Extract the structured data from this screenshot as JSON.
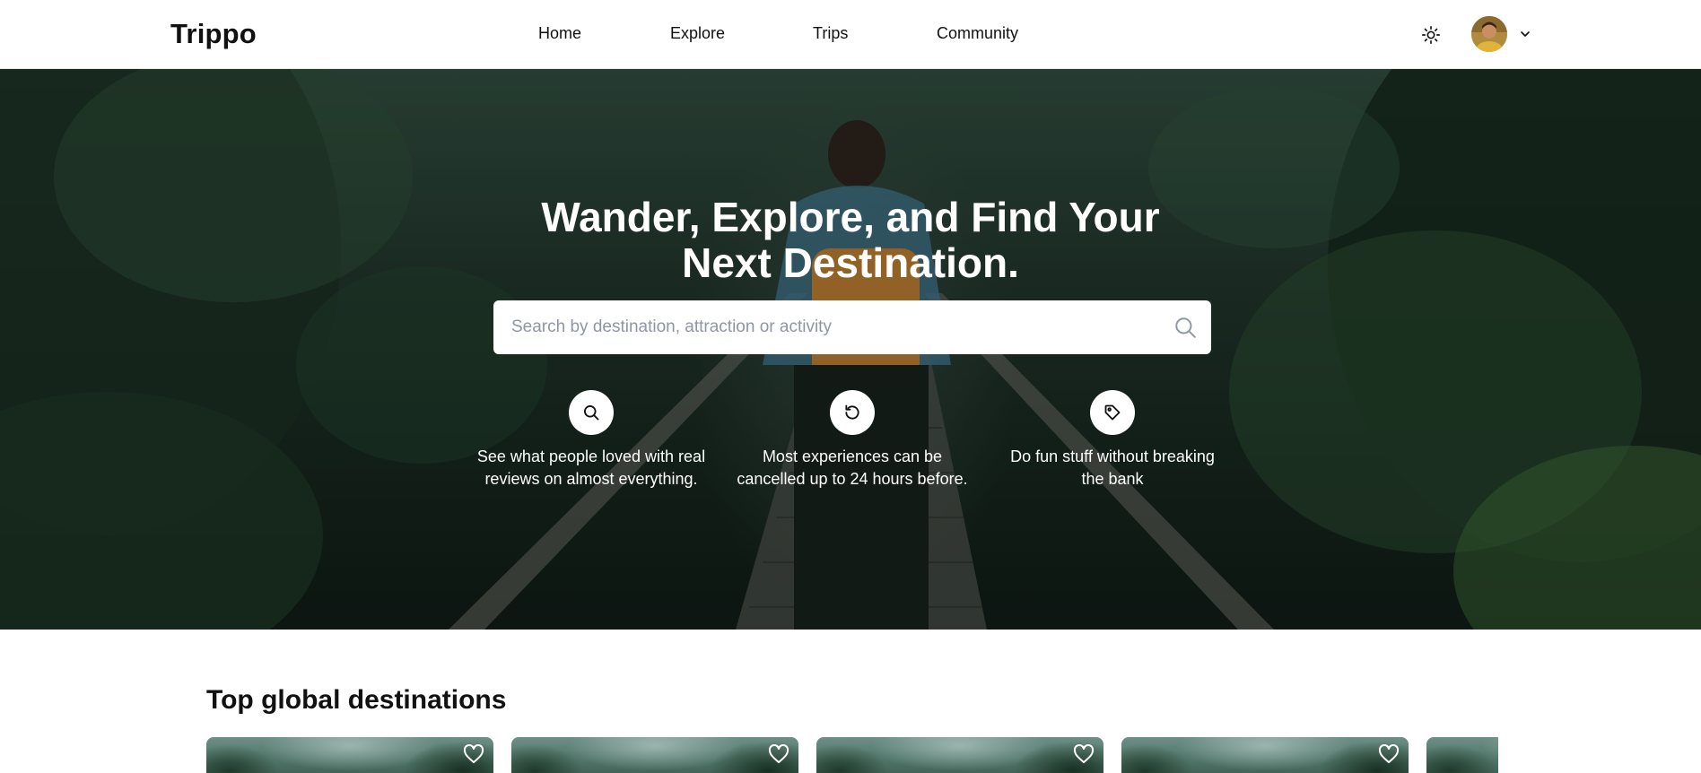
{
  "header": {
    "logo": "Trippo",
    "nav": [
      {
        "label": "Home"
      },
      {
        "label": "Explore"
      },
      {
        "label": "Trips"
      },
      {
        "label": "Community"
      }
    ],
    "theme_icon": "sun-icon",
    "avatar_icon": "user-avatar",
    "menu_icon": "chevron-down-icon"
  },
  "hero": {
    "title_line1": "Wander, Explore, and Find Your",
    "title_line2": "Next Destination.",
    "search": {
      "placeholder": "Search by destination, attraction or activity",
      "icon": "search-icon"
    },
    "features": [
      {
        "icon": "search-icon",
        "line1": "See what people loved with real",
        "line2": "reviews on almost everything."
      },
      {
        "icon": "refresh-icon",
        "line1": "Most experiences can be",
        "line2": "cancelled up to 24 hours before."
      },
      {
        "icon": "tag-icon",
        "line1": "Do fun stuff without breaking",
        "line2": "the bank"
      }
    ]
  },
  "section": {
    "title": "Top global destinations",
    "cards": [
      {
        "icon": "heart-icon"
      },
      {
        "icon": "heart-icon"
      },
      {
        "icon": "heart-icon"
      },
      {
        "icon": "heart-icon"
      },
      {
        "icon": "heart-icon"
      }
    ]
  },
  "colors": {
    "hero_dark": "#15231c",
    "white": "#ffffff",
    "text": "#111111",
    "placeholder": "#8f96a3"
  }
}
